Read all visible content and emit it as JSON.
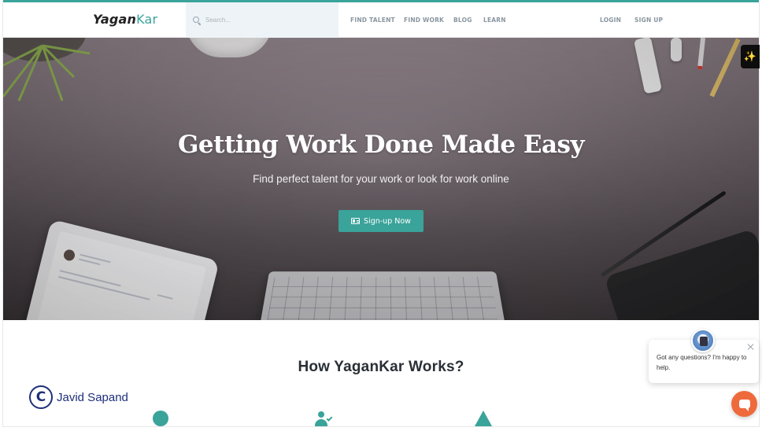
{
  "header": {
    "logo_part1": "Yagan",
    "logo_part2": "Kar",
    "search_placeholder": "Search...",
    "nav": {
      "find_talent": "FIND TALENT",
      "find_work": "FIND WORK",
      "blog": "BLOG",
      "learn": "LEARN",
      "login": "LOGIN",
      "signup": "SIGN UP"
    }
  },
  "hero": {
    "title": "Getting Work Done Made Easy",
    "subtitle": "Find perfect talent for your work or look for work online",
    "cta_label": "Sign-up Now"
  },
  "how": {
    "title": "How YaganKar Works?"
  },
  "watermark": {
    "symbol": "C",
    "name": "Javid Sapand"
  },
  "chat": {
    "message": "Got any questions? I'm happy to help."
  },
  "sparkle": {
    "glyph": "✨"
  },
  "colors": {
    "accent": "#3aa39a",
    "chat_launcher": "#ee6a3d",
    "watermark": "#1e2f7a"
  }
}
